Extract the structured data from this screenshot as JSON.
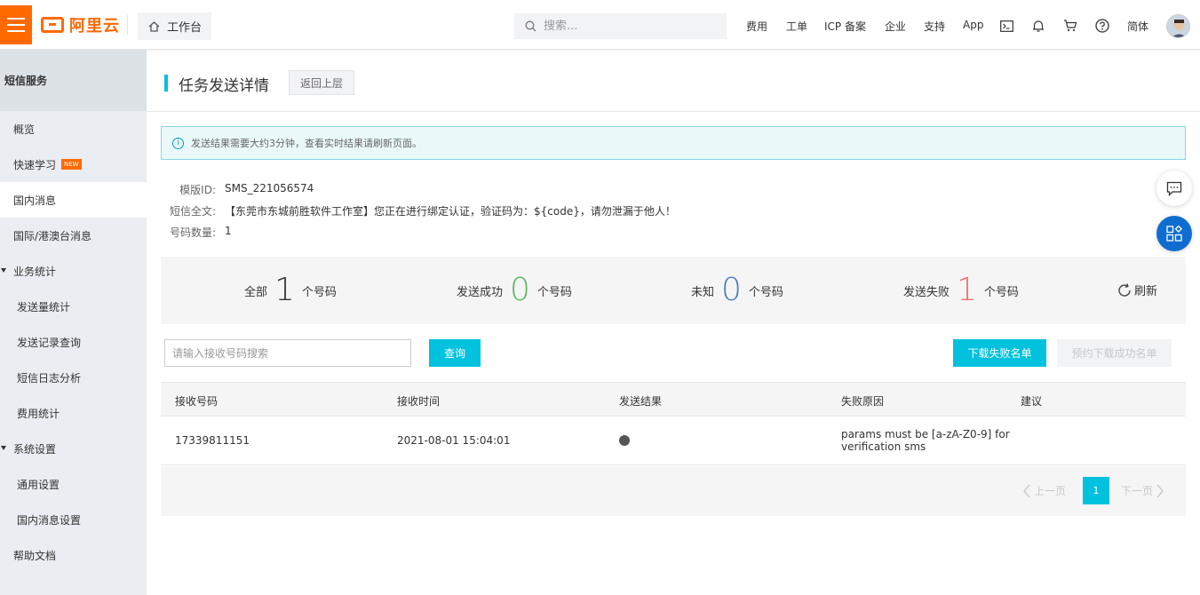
{
  "topbar": {
    "logo_text": "阿里云",
    "workbench": "工作台",
    "search_placeholder": "搜索...",
    "nav": [
      "费用",
      "工单",
      "ICP 备案",
      "企业",
      "支持",
      "App"
    ],
    "language": "简体"
  },
  "sidebar": {
    "title": "短信服务",
    "items": [
      {
        "label": "概览"
      },
      {
        "label": "快速学习",
        "badge": "NEW"
      },
      {
        "label": "国内消息"
      },
      {
        "label": "国际/港澳台消息"
      },
      {
        "label": "业务统计"
      },
      {
        "label": "发送量统计"
      },
      {
        "label": "发送记录查询"
      },
      {
        "label": "短信日志分析"
      },
      {
        "label": "费用统计"
      },
      {
        "label": "系统设置"
      },
      {
        "label": "通用设置"
      },
      {
        "label": "国内消息设置"
      },
      {
        "label": "帮助文档"
      }
    ]
  },
  "page": {
    "title": "任务发送详情",
    "back": "返回上层",
    "notice": "发送结果需要大约3分钟，查看实时结果请刷新页面。"
  },
  "meta": {
    "template_key": "模版ID:",
    "template_val": "SMS_221056574",
    "content_key": "短信全文:",
    "content_val": "【东莞市东城前胜软件工作室】您正在进行绑定认证，验证码为：${code}，请勿泄漏于他人！",
    "count_key": "号码数量:",
    "count_val": "1"
  },
  "stats": {
    "all_label": "全部",
    "all_num": "1",
    "all_unit": "个号码",
    "success_label": "发送成功",
    "success_num": "0",
    "success_unit": "个号码",
    "unknown_label": "未知",
    "unknown_num": "0",
    "unknown_unit": "个号码",
    "fail_label": "发送失败",
    "fail_num": "1",
    "fail_unit": "个号码",
    "refresh": "刷新",
    "colors": {
      "all": "#333333",
      "success": "#5cb85c",
      "unknown": "#4a7cb8",
      "fail": "#ee6e6e"
    }
  },
  "filter": {
    "placeholder": "请输入接收号码搜索",
    "query": "查询",
    "download_fail": "下载失败名单",
    "download_success": "预约下载成功名单"
  },
  "table": {
    "headers": [
      "接收号码",
      "接收时间",
      "发送结果",
      "失败原因",
      "建议"
    ],
    "rows": [
      {
        "phone": "17339811151",
        "time": "2021-08-01 15:04:01",
        "result": "",
        "reason_line1": "params must be [a-zA-Z0-9] for",
        "reason_line2": "verification sms",
        "advice": ""
      }
    ]
  },
  "pager": {
    "prev": "上一页",
    "current": "1",
    "next": "下一页"
  }
}
